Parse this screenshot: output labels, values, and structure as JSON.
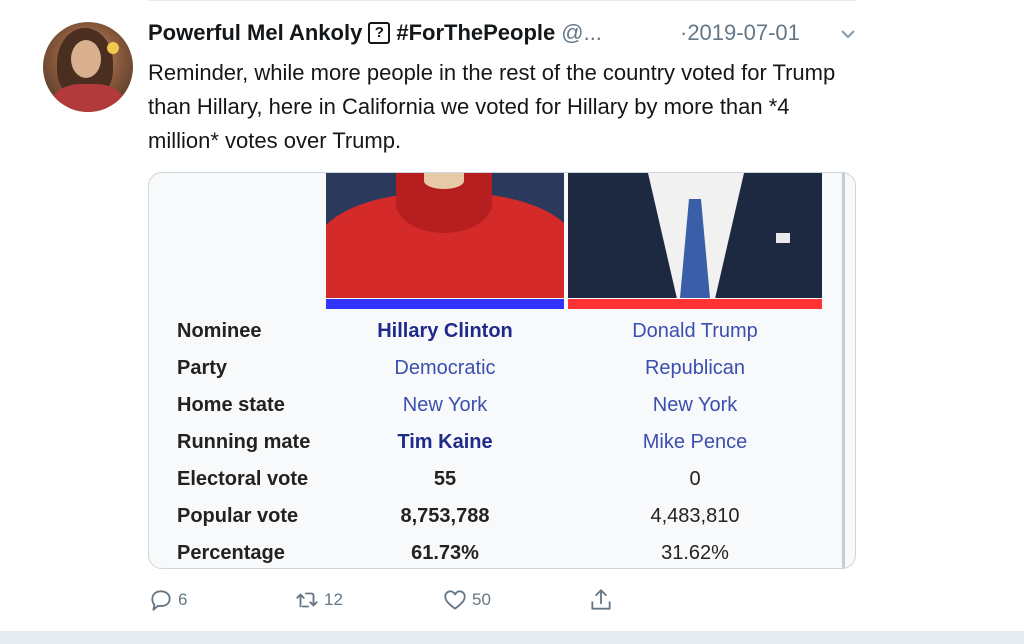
{
  "tweet": {
    "author_name": "Powerful Mel Ankoly",
    "badge_glyph": "?",
    "hashtag": "#ForThePeople",
    "handle": "@...",
    "date": "·2019-07-01",
    "text": "Reminder, while more people in the rest of the country voted for Trump than Hillary, here in California we voted for Hillary by more than *4 million* votes over Trump."
  },
  "card": {
    "rows": [
      {
        "label": "Nominee",
        "c1": "Hillary Clinton",
        "c2": "Donald Trump"
      },
      {
        "label": "Party",
        "c1": "Democratic",
        "c2": "Republican"
      },
      {
        "label": "Home state",
        "c1": "New York",
        "c2": "New York"
      },
      {
        "label": "Running mate",
        "c1": "Tim Kaine",
        "c2": "Mike Pence"
      },
      {
        "label": "Electoral vote",
        "c1": "55",
        "c2": "0"
      },
      {
        "label": "Popular vote",
        "c1": "8,753,788",
        "c2": "4,483,810"
      },
      {
        "label": "Percentage",
        "c1": "61.73%",
        "c2": "31.62%"
      }
    ],
    "colors": {
      "democratic": "#3333ff",
      "republican": "#ff3333"
    }
  },
  "actions": {
    "reply_count": "6",
    "retweet_count": "12",
    "like_count": "50",
    "icons": [
      "reply-icon",
      "retweet-icon",
      "like-icon",
      "share-icon"
    ]
  },
  "colors": {
    "secondary_text": "#657786",
    "link": "#3b4fb0"
  }
}
